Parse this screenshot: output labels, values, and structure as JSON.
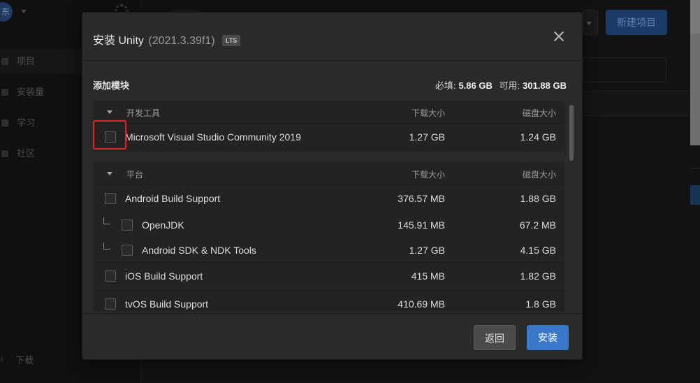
{
  "background": {
    "avatar_text": "东",
    "nav": [
      {
        "label": "项目"
      },
      {
        "label": "安装量"
      },
      {
        "label": "学习"
      },
      {
        "label": "社区"
      }
    ],
    "download_label": "下载",
    "new_project_label": "新建项目"
  },
  "dialog": {
    "title": "安装 Unity",
    "version": "(2021.3.39f1)",
    "badge": "LTS",
    "section_title": "添加模块",
    "required_label": "必填:",
    "required_value": "5.86 GB",
    "available_label": "可用:",
    "available_value": "301.88 GB",
    "back_label": "返回",
    "install_label": "安装"
  },
  "modules": {
    "col_download": "下载大小",
    "col_disk": "磁盘大小",
    "groups": [
      {
        "name": "开发工具",
        "rows": [
          {
            "name": "Microsoft Visual Studio Community 2019",
            "download": "1.27 GB",
            "disk": "1.24 GB",
            "checked": false,
            "highlighted": true
          }
        ]
      },
      {
        "name": "平台",
        "rows": [
          {
            "name": "Android Build Support",
            "download": "376.57 MB",
            "disk": "1.88 GB",
            "checked": false
          },
          {
            "name": "OpenJDK",
            "download": "145.91 MB",
            "disk": "67.2 MB",
            "checked": false,
            "child": true
          },
          {
            "name": "Android SDK & NDK Tools",
            "download": "1.27 GB",
            "disk": "4.15 GB",
            "checked": false,
            "child": true
          },
          {
            "name": "iOS Build Support",
            "download": "415 MB",
            "disk": "1.82 GB",
            "checked": false
          },
          {
            "name": "tvOS Build Support",
            "download": "410.69 MB",
            "disk": "1.8 GB",
            "checked": false
          }
        ]
      }
    ]
  },
  "colors": {
    "accent": "#3a78c9",
    "highlight": "#e02424",
    "dialog_bg": "#2a2a2a"
  }
}
